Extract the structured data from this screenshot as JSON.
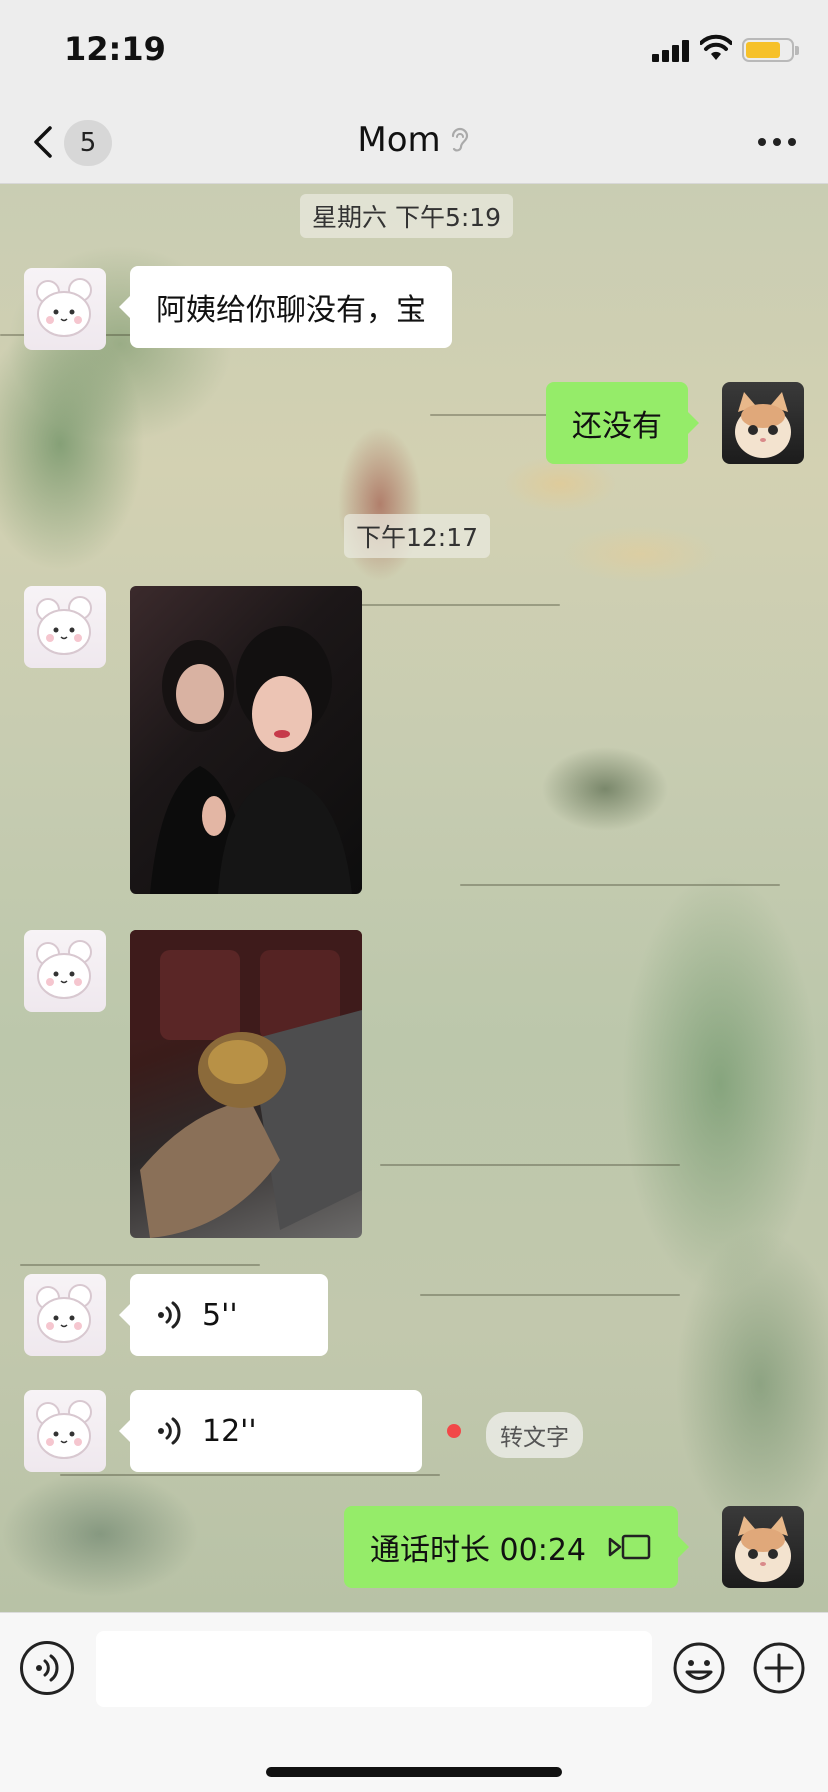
{
  "status_bar": {
    "time": "12:19",
    "battery_color": "#f6c12a"
  },
  "nav": {
    "unread_count": "5",
    "title": "Mom",
    "title_icon": "ear-icon",
    "more_icon": "more-icon"
  },
  "chat": {
    "timestamps": [
      "星期六 下午5:19",
      "下午12:17"
    ],
    "messages": [
      {
        "sender": "mom",
        "type": "text",
        "text": "阿姨给你聊没有，宝"
      },
      {
        "sender": "me",
        "type": "text",
        "text": "还没有"
      },
      {
        "sender": "mom",
        "type": "image",
        "content": "selfie-photo"
      },
      {
        "sender": "mom",
        "type": "image",
        "content": "food-photo"
      },
      {
        "sender": "mom",
        "type": "voice",
        "duration": "5''"
      },
      {
        "sender": "mom",
        "type": "voice",
        "duration": "12''",
        "unread": true,
        "action": "转文字"
      },
      {
        "sender": "me",
        "type": "call",
        "text": "通话时长 00:24"
      }
    ]
  },
  "input_bar": {
    "placeholder": ""
  },
  "colors": {
    "my_bubble": "#95ec69",
    "their_bubble": "#ffffff",
    "unread_dot": "#f24848"
  }
}
